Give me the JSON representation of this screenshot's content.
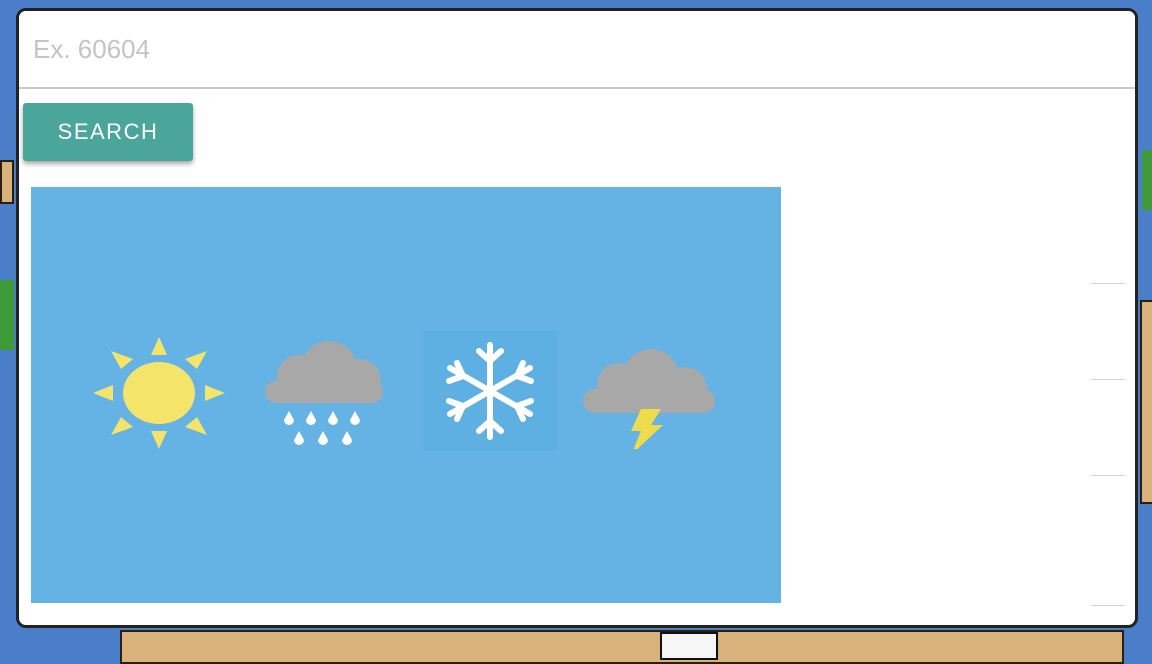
{
  "search": {
    "placeholder": "Ex. 60604",
    "value": ""
  },
  "search_button": {
    "label": "SEARCH"
  },
  "weather_icons": [
    "sun-icon",
    "rain-cloud-icon",
    "snowflake-icon",
    "thunderstorm-cloud-icon"
  ],
  "colors": {
    "button": "#4aa59b",
    "banner": "#64b3e4",
    "sun": "#f4e46a",
    "cloud": "#a8a8a8",
    "lightning": "#f0dc4a",
    "page_background": "#4a7ec8"
  }
}
